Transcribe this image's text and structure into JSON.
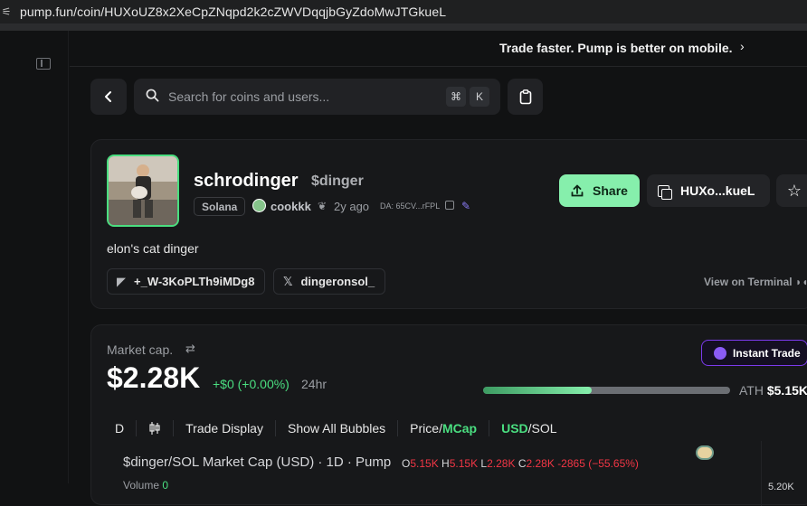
{
  "browser": {
    "url": "pump.fun/coin/HUXoUZ8x2XeCpZNqpd2k2cZWVDqqjbGyZdoMwJTGkueL"
  },
  "banner": {
    "text": "Trade faster. Pump is better on mobile.",
    "chevron": "›"
  },
  "search": {
    "placeholder": "Search for coins and users...",
    "shortcut_mod": "⌘",
    "shortcut_key": "K"
  },
  "coin": {
    "name": "schrodinger",
    "ticker": "$dinger",
    "chain": "Solana",
    "creator": "cookkk",
    "age": "2y ago",
    "da": "DA: 65CV...rFPL",
    "description": "elon's cat dinger",
    "telegram": "+_W-3KoPLTh9iMDg8",
    "twitter": "dingeronsol_",
    "terminal_link": "View on Terminal",
    "share_label": "Share",
    "address_short": "HUXo...kueL"
  },
  "market": {
    "label": "Market cap.",
    "value": "$2.28K",
    "change": "+$0 (+0.00%)",
    "period": "24hr",
    "instant_trade": "Instant Trade",
    "ath_label": "ATH",
    "ath_value": "$5.15K",
    "ath_progress": 0.44
  },
  "chart_toolbar": {
    "interval": "D",
    "trade_display": "Trade Display",
    "bubbles": "Show All Bubbles",
    "price": "Price/",
    "mcap": "MCap",
    "usd": "USD",
    "sol": "/SOL"
  },
  "chart": {
    "title": "$dinger/SOL Market Cap (USD) · 1D · Pump",
    "o_label": "O",
    "o_value": "5.15K",
    "h_label": "H",
    "h_value": "5.15K",
    "l_label": "L",
    "l_value": "2.28K",
    "c_label": "C",
    "c_value": "2.28K",
    "delta": "-2865 (−55.65%)",
    "price_tick": "5.20K",
    "volume_label": "Volume",
    "volume_value": "0"
  },
  "icons": [
    "tune-icon",
    "sidebar-collapse-icon",
    "chevron-left-icon",
    "search-icon",
    "clipboard-icon",
    "upload-icon",
    "copy-icon",
    "star-icon",
    "sprout-icon",
    "edit-icon",
    "telegram-icon",
    "x-icon",
    "swap-icon",
    "candles-icon",
    "flame-icon"
  ],
  "colors": {
    "accent_green": "#86efac",
    "up_green": "#4ade80",
    "down_red": "#f23645",
    "instant_purple": "#7c3aed"
  }
}
